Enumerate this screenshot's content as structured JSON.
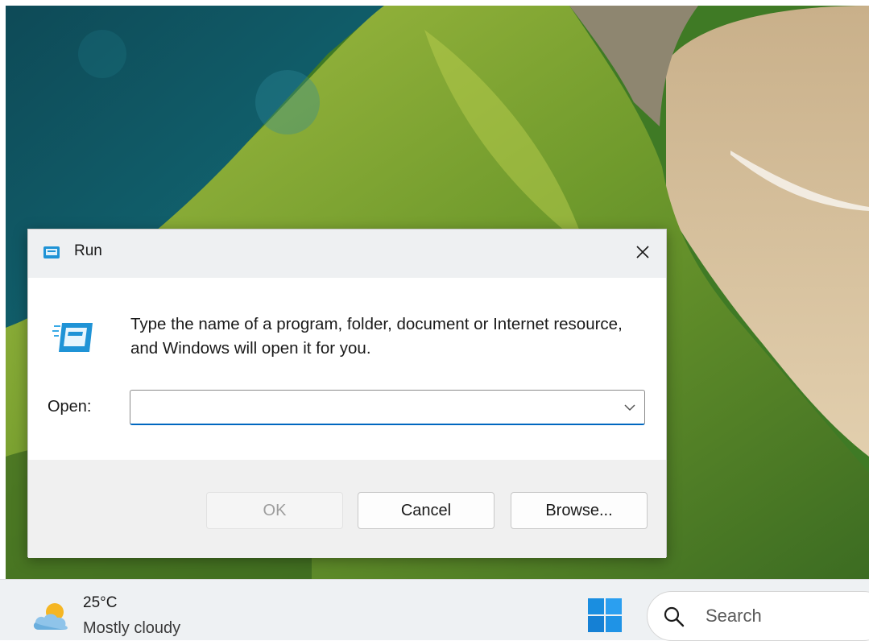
{
  "run_dialog": {
    "title": "Run",
    "description": "Type the name of a program, folder, document or Internet resource, and Windows will open it for you.",
    "open_label": "Open:",
    "open_value": "",
    "buttons": {
      "ok": "OK",
      "cancel": "Cancel",
      "browse": "Browse..."
    }
  },
  "taskbar": {
    "weather": {
      "temperature": "25°C",
      "condition": "Mostly cloudy"
    },
    "search": {
      "label": "Search"
    }
  },
  "colors": {
    "accent": "#0067c0",
    "titlebar": "#eef0f2",
    "footer": "#f0f0f0",
    "taskbar": "#eef1f3",
    "run_icon": "#1f93d6"
  },
  "icons": [
    "run-app-icon",
    "close-icon",
    "chevron-down-icon",
    "weather-cloud-sun-icon",
    "windows-start-icon",
    "search-icon"
  ]
}
